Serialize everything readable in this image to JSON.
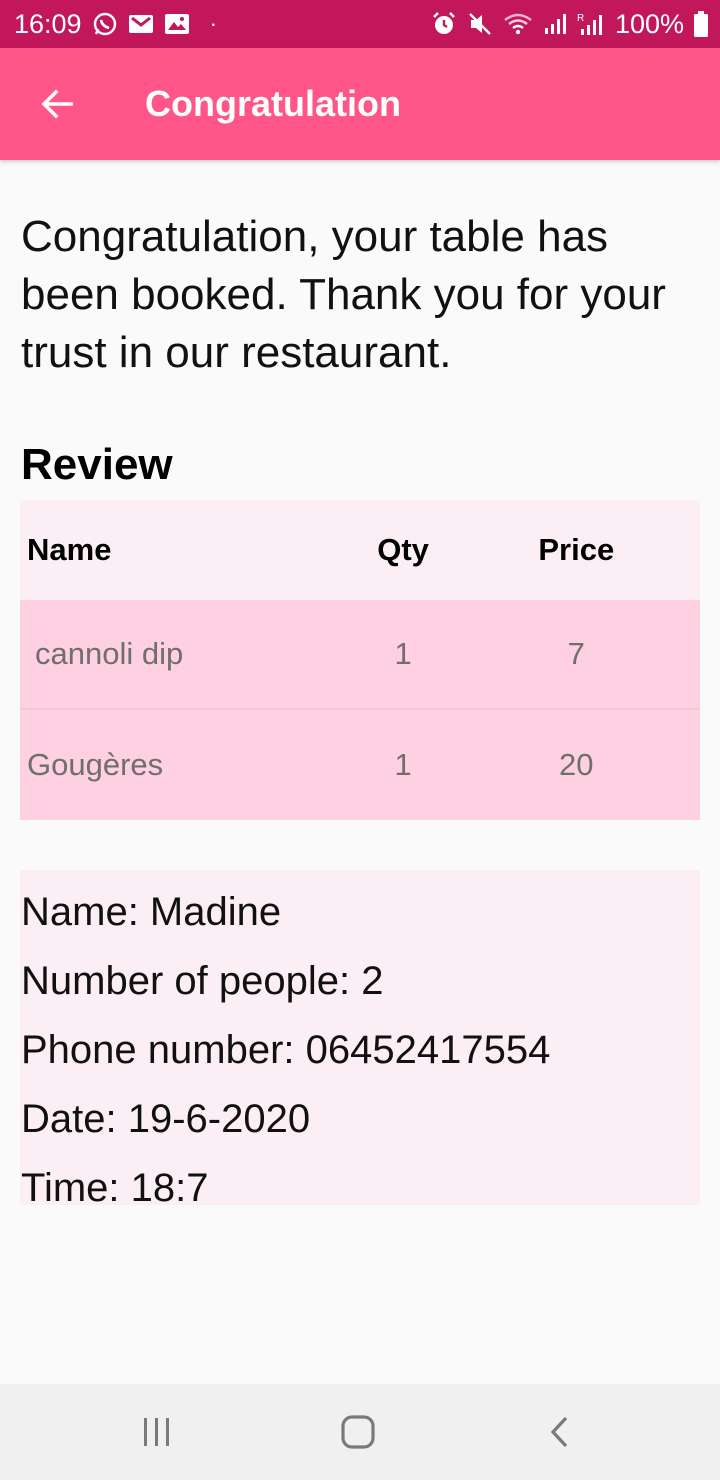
{
  "status_bar": {
    "time": "16:09",
    "battery": "100%",
    "left_icons": [
      "whatsapp-icon",
      "gmail-icon",
      "gallery-icon"
    ],
    "right_icons": [
      "alarm-icon",
      "mute-icon",
      "wifi-icon",
      "signal-icon",
      "signal-r-icon",
      "battery-icon"
    ]
  },
  "app_bar": {
    "title": "Congratulation",
    "back_icon": "arrow-left-icon"
  },
  "message": "Congratulation, your table has been booked. Thank you for your trust in our restaurant.",
  "review": {
    "heading": "Review",
    "columns": [
      "Name",
      "Qty",
      "Price"
    ],
    "rows": [
      {
        "name": "cannoli dip",
        "qty": "1",
        "price": "7"
      },
      {
        "name": "Gougères",
        "qty": "1",
        "price": "20"
      }
    ]
  },
  "details": {
    "name": "Name: Madine",
    "people": "Number of people: 2",
    "phone": "Phone number: 06452417554",
    "date": "Date: 19-6-2020",
    "time": "Time: 18:7"
  },
  "nav_bar": {
    "icons": [
      "recents-icon",
      "home-icon",
      "back-icon"
    ]
  },
  "colors": {
    "status_bar": "#c2185b",
    "app_bar": "#ff5588",
    "table_header": "#fbeff5",
    "table_row": "#ffcfe2"
  }
}
